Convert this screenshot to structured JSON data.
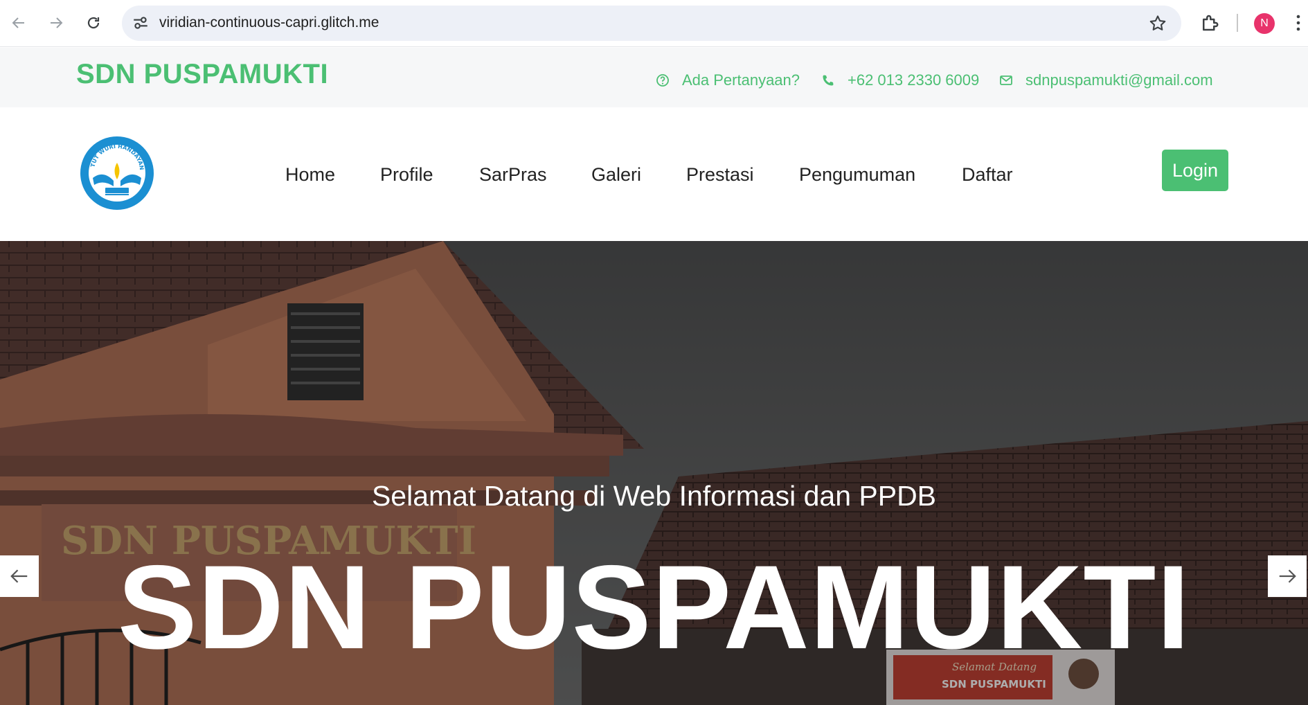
{
  "browser": {
    "url": "viridian-continuous-capri.glitch.me",
    "profile_initial": "N"
  },
  "topbar": {
    "brand": "SDN PUSPAMUKTI",
    "question": "Ada Pertanyaan?",
    "phone": "+62 013 2330 6009",
    "email": "sdnpuspamukti@gmail.com"
  },
  "nav": {
    "logo_text": "TUT WURI HANDAYANI",
    "items": [
      "Home",
      "Profile",
      "SarPras",
      "Galeri",
      "Prestasi",
      "Pengumuman",
      "Daftar"
    ],
    "login": "Login"
  },
  "hero": {
    "welcome": "Selamat Datang di Web Informasi dan PPDB",
    "headline": "SDN PUSPAMUKTI",
    "sign_text": "SDN PUSPAMUKTI",
    "banner_line1": "Selamat Datang",
    "banner_line2": "SDN PUSPAMUKTI"
  },
  "colors": {
    "accent": "#4bbf73",
    "avatar": "#e8336b"
  },
  "icons": [
    "back-arrow-icon",
    "forward-arrow-icon",
    "reload-icon",
    "site-settings-icon",
    "bookmark-star-icon",
    "extensions-icon",
    "menu-dots-icon",
    "question-circle-icon",
    "phone-icon",
    "envelope-icon",
    "arrow-left-icon",
    "arrow-right-icon"
  ]
}
